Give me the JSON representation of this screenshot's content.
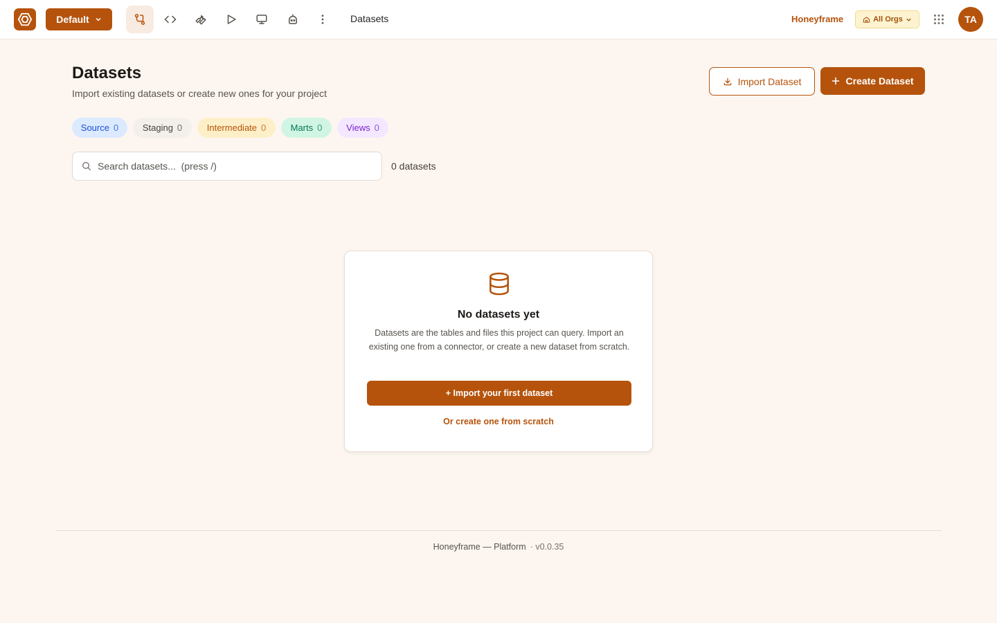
{
  "topbar": {
    "project_label": "Default",
    "breadcrumb": "Datasets",
    "org_name": "Honeyframe",
    "org_select": "All Orgs",
    "avatar_initials": "TA",
    "nav_icons": [
      "git-branch-icon",
      "code-icon",
      "wrench-icon",
      "play-icon",
      "monitor-icon",
      "robot-icon",
      "more-vertical-icon"
    ]
  },
  "header": {
    "title": "Datasets",
    "subtitle": "Import existing datasets or create new ones for your project",
    "import_button": "Import Dataset",
    "create_button": "Create Dataset"
  },
  "chips": [
    {
      "label": "Source",
      "count": "0",
      "color": "#1d4ed8",
      "bg": "#dbeafe"
    },
    {
      "label": "Staging",
      "count": "0",
      "color": "#44403c",
      "bg": "#f3efeb"
    },
    {
      "label": "Intermediate",
      "count": "0",
      "color": "#b45309",
      "bg": "#fdf0c8"
    },
    {
      "label": "Marts",
      "count": "0",
      "color": "#047857",
      "bg": "#d1f5e4"
    },
    {
      "label": "Views",
      "count": "0",
      "color": "#7e22ce",
      "bg": "#f3e8ff"
    }
  ],
  "search": {
    "placeholder": "Search datasets...  (press /)",
    "value": ""
  },
  "results_count": "0 datasets",
  "empty_state": {
    "icon": "database-icon",
    "title": "No datasets yet",
    "description": "Datasets are the tables and files this project can query. Import an existing one from a connector, or create a new dataset from scratch.",
    "primary_action": "+ Import your first dataset",
    "secondary_action": "Or create one from scratch"
  },
  "footer": {
    "text": "Honeyframe — Platform",
    "version": "· v0.0.35"
  },
  "colors": {
    "accent": "#b5530c",
    "background": "#fdf6f0"
  }
}
